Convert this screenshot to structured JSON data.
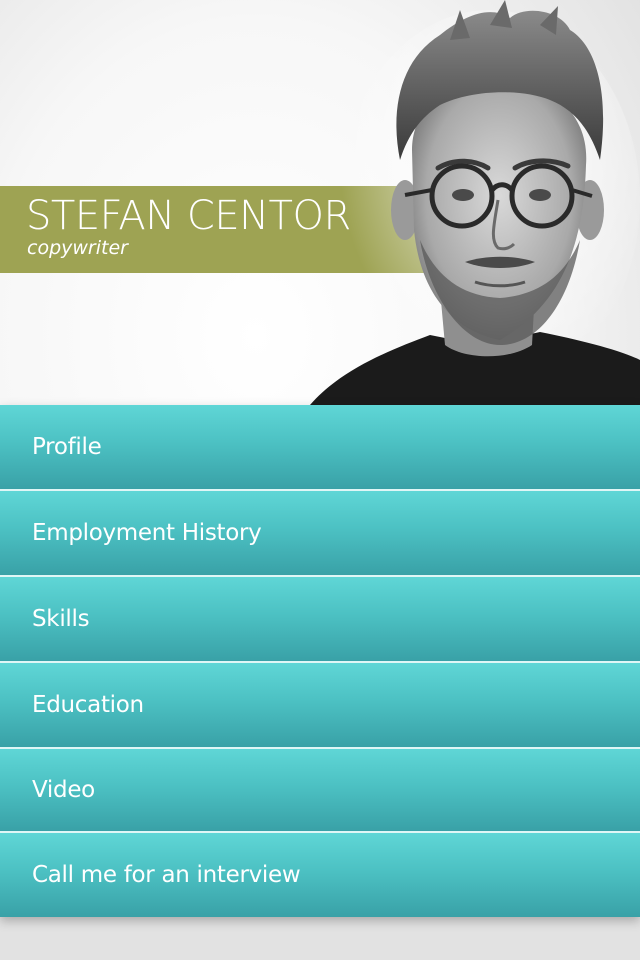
{
  "profile": {
    "name": "STEFAN CENTOR",
    "role": "copywriter",
    "photo_description": "black-and-white portrait photo",
    "band_color": "#9ea353"
  },
  "menu": {
    "accent_color": "#4cc1c3",
    "items": [
      {
        "label": "Profile"
      },
      {
        "label": "Employment History"
      },
      {
        "label": "Skills"
      },
      {
        "label": "Education"
      },
      {
        "label": "Video"
      },
      {
        "label": "Call me for an interview"
      }
    ]
  }
}
